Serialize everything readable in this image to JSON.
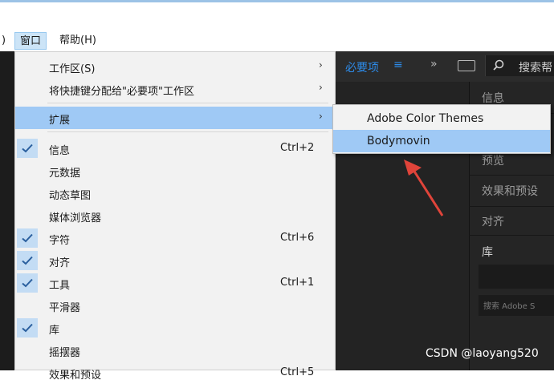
{
  "menubar": {
    "partial_left": ")",
    "window": "窗口",
    "help": "帮助(H)"
  },
  "app_header": {
    "workspace": "必要项",
    "menu_glyph": "≡",
    "more_glyph": "»",
    "search_placeholder": "搜索帮"
  },
  "right_panel": {
    "items": [
      "信息",
      "预览",
      "效果和预设",
      "对齐",
      "库"
    ],
    "library_search_placeholder": "搜索 Adobe S"
  },
  "menu": {
    "items": [
      {
        "label": "工作区(S)",
        "submenu": true
      },
      {
        "label": "将快捷键分配给\"必要项\"工作区",
        "submenu": true
      },
      {
        "label": "扩展",
        "submenu": true,
        "highlight": true
      },
      {
        "label": "信息",
        "checked": true,
        "shortcut": "Ctrl+2"
      },
      {
        "label": "元数据"
      },
      {
        "label": "动态草图"
      },
      {
        "label": "媒体浏览器"
      },
      {
        "label": "字符",
        "checked": true,
        "shortcut": "Ctrl+6"
      },
      {
        "label": "对齐",
        "checked": true
      },
      {
        "label": "工具",
        "checked": true,
        "shortcut": "Ctrl+1"
      },
      {
        "label": "平滑器"
      },
      {
        "label": "库",
        "checked": true
      },
      {
        "label": "摇摆器"
      },
      {
        "label": "效果和预设",
        "shortcut": "Ctrl+5"
      }
    ],
    "arrow_glyph": "›"
  },
  "submenu": {
    "items": [
      {
        "label": "Adobe Color Themes"
      },
      {
        "label": "Bodymovin",
        "highlight": true
      }
    ]
  },
  "watermark": "CSDN @laoyang520",
  "colors": {
    "highlight": "#9fc9f5",
    "check_bg": "#c3dcf4",
    "accent_blue": "#2d8ceb",
    "arrow_red": "#e0443a",
    "dark_bg": "#232323"
  }
}
